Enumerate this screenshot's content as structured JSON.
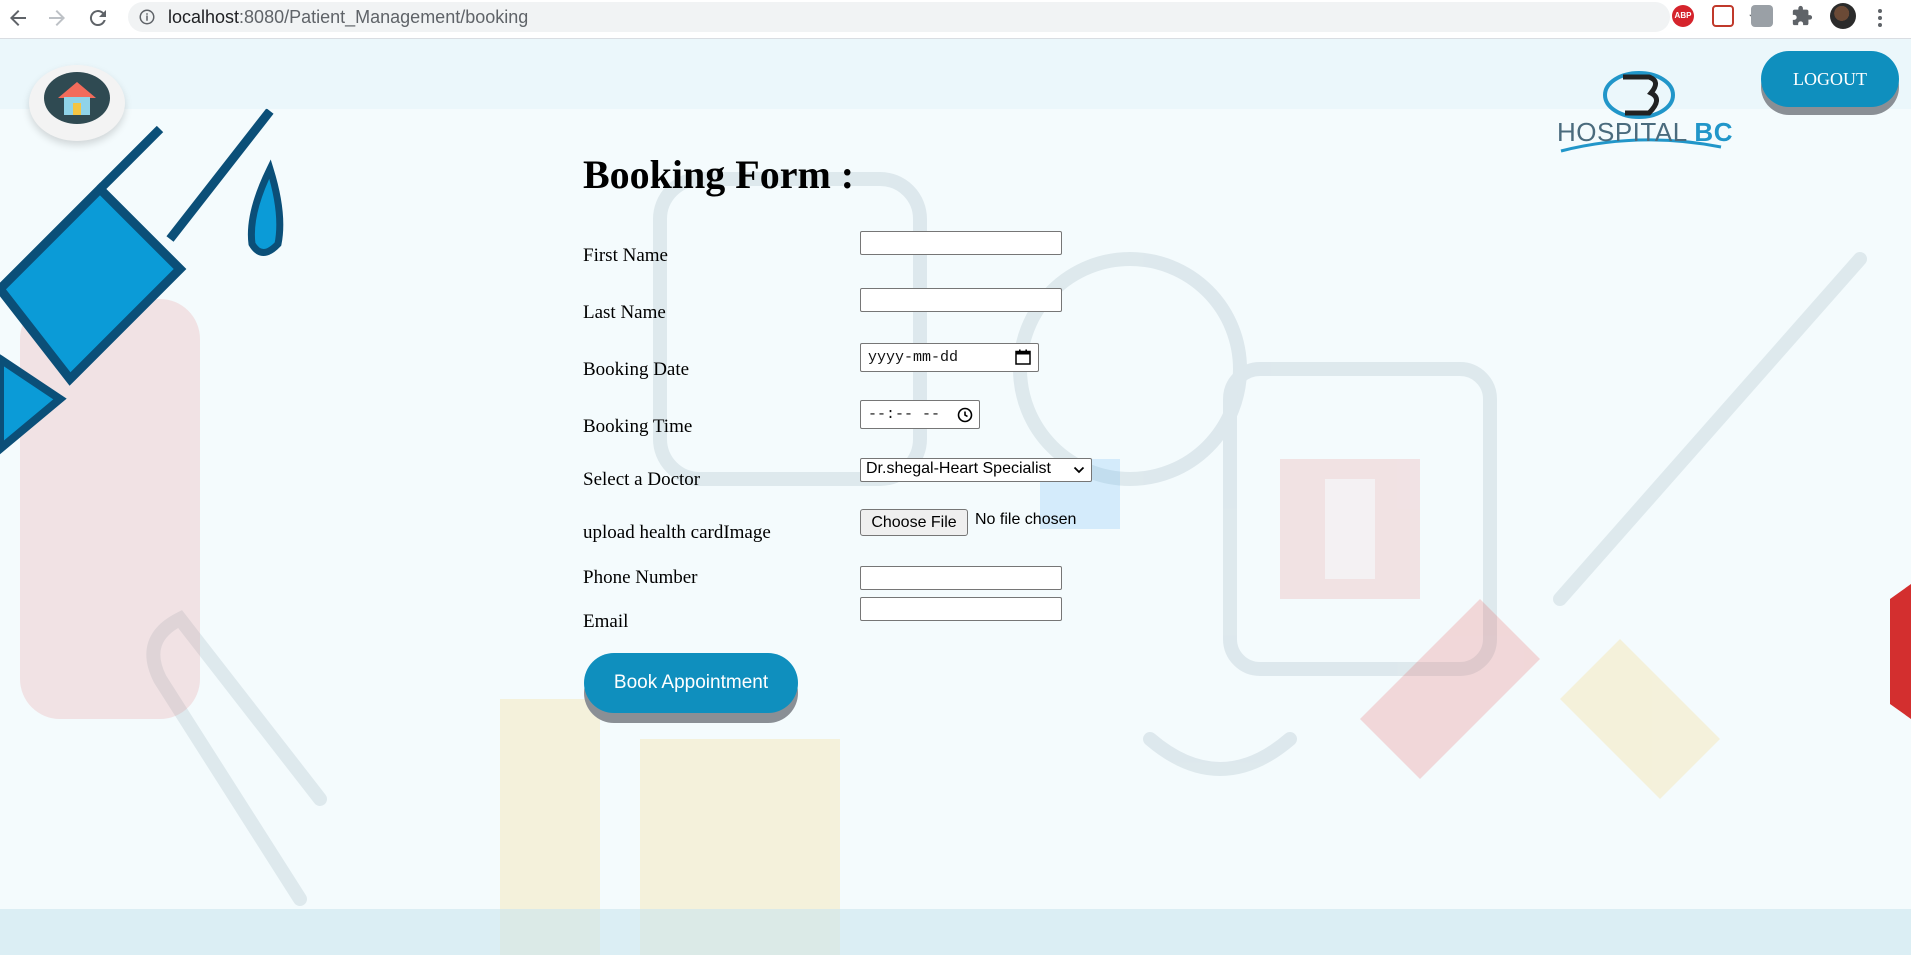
{
  "browser": {
    "url_host": "localhost",
    "url_path": ":8080/Patient_Management/booking"
  },
  "header": {
    "logo_text_main": "HOSPITAL ",
    "logo_text_accent": "BC",
    "logout_label": "LOGOUT"
  },
  "form": {
    "title": "Booking Form :",
    "fields": {
      "first_name_label": "First Name",
      "last_name_label": "Last Name",
      "booking_date_label": "Booking Date",
      "booking_date_placeholder": "yyyy-mm-dd",
      "booking_time_label": "Booking Time",
      "booking_time_placeholder": "--:-- --",
      "doctor_label": "Select a Doctor",
      "doctor_selected": "Dr.shegal-Heart Specialist",
      "health_card_label": "upload health cardImage",
      "file_button_label": "Choose File",
      "file_status": "No file chosen",
      "phone_label": "Phone Number",
      "email_label": "Email"
    },
    "submit_label": "Book Appointment"
  },
  "colors": {
    "primary_button": "#0f8fbe",
    "button_shadow": "#8a8f95",
    "page_background": "#f4fbfd"
  }
}
